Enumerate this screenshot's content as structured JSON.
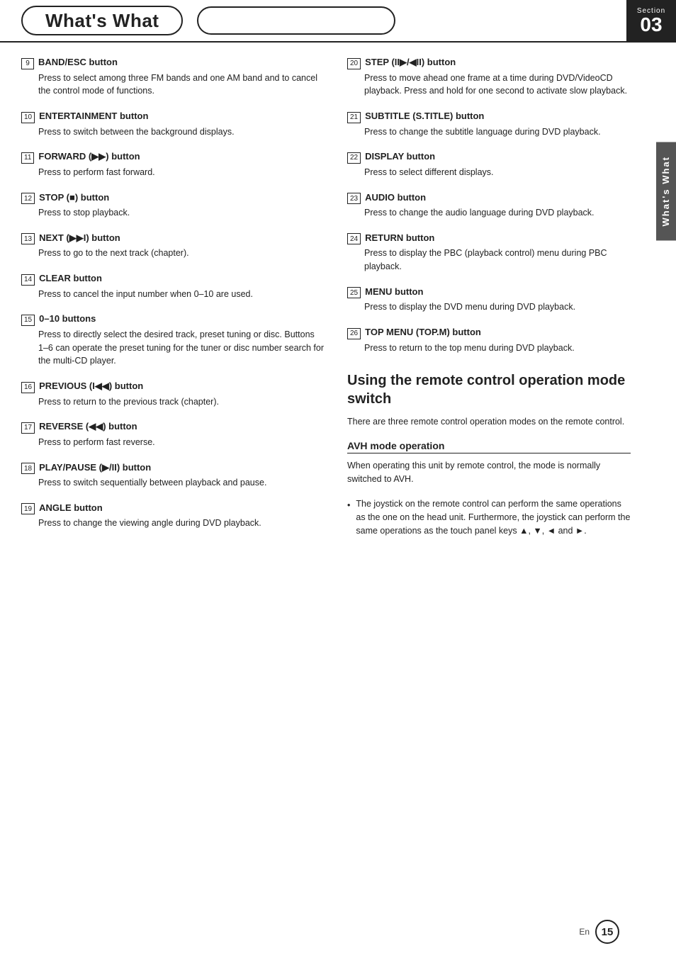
{
  "page": {
    "title": "What's What",
    "section": "03",
    "section_label": "Section",
    "page_number": "15",
    "page_lang": "En",
    "side_tab_label": "What's What"
  },
  "left_items": [
    {
      "num": "9",
      "title": "BAND/ESC button",
      "body": "Press to select among three FM bands and one AM band and to cancel the control mode of functions."
    },
    {
      "num": "10",
      "title": "ENTERTAINMENT button",
      "body": "Press to switch between the background displays."
    },
    {
      "num": "11",
      "title": "FORWARD (▶▶) button",
      "body": "Press to perform fast forward."
    },
    {
      "num": "12",
      "title": "STOP (■) button",
      "body": "Press to stop playback."
    },
    {
      "num": "13",
      "title": "NEXT (▶▶I) button",
      "body": "Press to go to the next track (chapter)."
    },
    {
      "num": "14",
      "title": "CLEAR button",
      "body": "Press to cancel the input number when 0–10 are used."
    },
    {
      "num": "15",
      "title": "0–10 buttons",
      "body": "Press to directly select the desired track, preset tuning or disc. Buttons 1–6 can operate the preset tuning for the tuner or disc number search for the multi-CD player."
    },
    {
      "num": "16",
      "title": "PREVIOUS (I◀◀) button",
      "body": "Press to return to the previous track (chapter)."
    },
    {
      "num": "17",
      "title": "REVERSE (◀◀) button",
      "body": "Press to perform fast reverse."
    },
    {
      "num": "18",
      "title": "PLAY/PAUSE (▶/II) button",
      "body": "Press to switch sequentially between playback and pause."
    },
    {
      "num": "19",
      "title": "ANGLE button",
      "body": "Press to change the viewing angle during DVD playback."
    }
  ],
  "right_items": [
    {
      "num": "20",
      "title": "STEP (II▶/◀II) button",
      "body": "Press to move ahead one frame at a time during DVD/VideoCD playback. Press and hold for one second to activate slow playback."
    },
    {
      "num": "21",
      "title": "SUBTITLE (S.TITLE) button",
      "body": "Press to change the subtitle language during DVD playback."
    },
    {
      "num": "22",
      "title": "DISPLAY button",
      "body": "Press to select different displays."
    },
    {
      "num": "23",
      "title": "AUDIO button",
      "body": "Press to change the audio language during DVD playback."
    },
    {
      "num": "24",
      "title": "RETURN button",
      "body": "Press to display the PBC (playback control) menu during PBC playback."
    },
    {
      "num": "25",
      "title": "MENU button",
      "body": "Press to display the DVD menu during DVD playback."
    },
    {
      "num": "26",
      "title": "TOP MENU (TOP.M) button",
      "body": "Press to return to the top menu during DVD playback."
    }
  ],
  "remote_section": {
    "heading": "Using the remote control operation mode switch",
    "intro": "There are three remote control operation modes on the remote control.",
    "sub_heading": "AVH mode operation",
    "avh_body": "When operating this unit by remote control, the mode is normally switched to AVH.",
    "bullet": "The joystick on the remote control can perform the same operations as the one on the head unit. Furthermore, the joystick can perform the same operations as the touch panel keys ▲, ▼, ◄ and ►."
  }
}
